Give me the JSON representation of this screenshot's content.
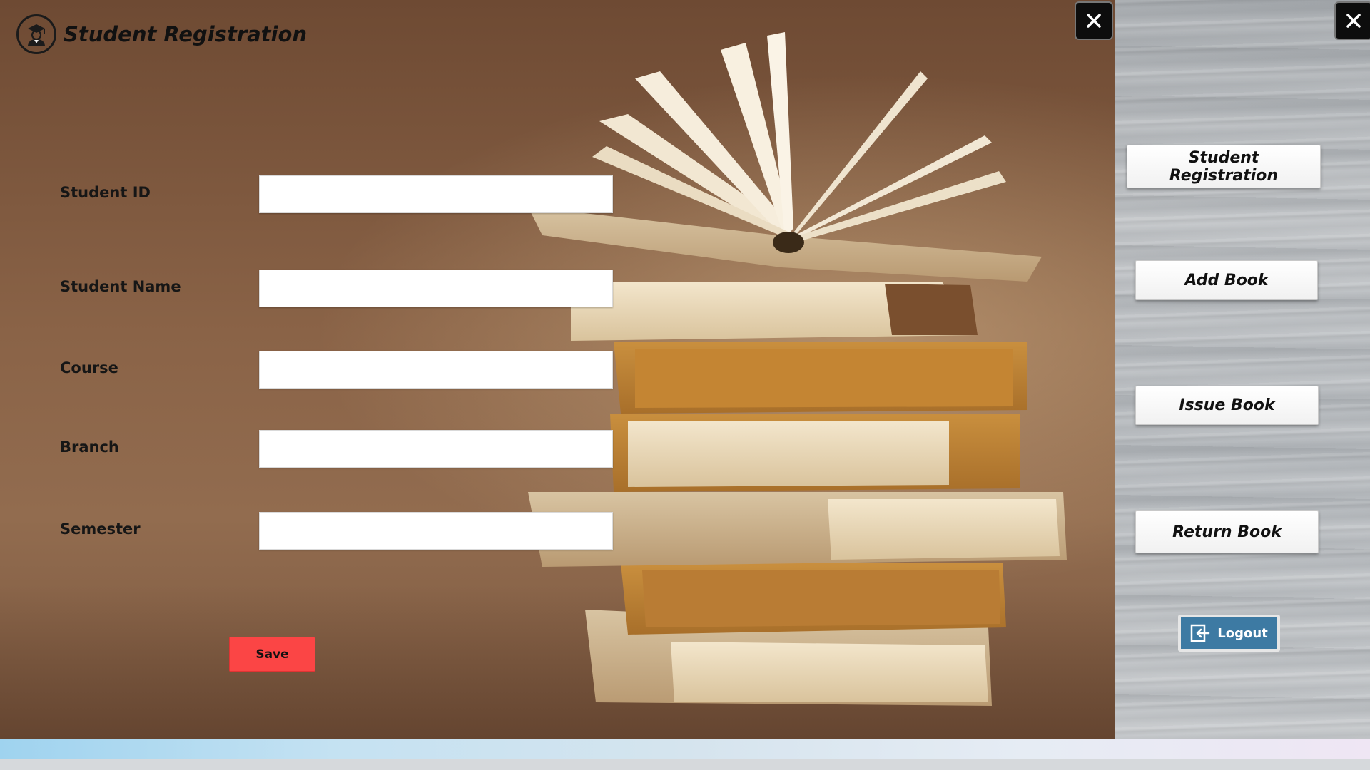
{
  "app": {
    "title": "Student Registration"
  },
  "form": {
    "fields": [
      {
        "label": "Student ID",
        "value": "",
        "placeholder": ""
      },
      {
        "label": "Student Name",
        "value": "",
        "placeholder": ""
      },
      {
        "label": "Course",
        "value": "",
        "placeholder": ""
      },
      {
        "label": "Branch",
        "value": "",
        "placeholder": ""
      },
      {
        "label": "Semester",
        "value": "",
        "placeholder": ""
      }
    ],
    "save_label": "Save"
  },
  "sidebar": {
    "items": [
      {
        "label": "Student Registration"
      },
      {
        "label": "Add Book"
      },
      {
        "label": "Issue Book"
      },
      {
        "label": "Return Book"
      }
    ],
    "logout_label": "Logout"
  },
  "colors": {
    "save_button": "#fb4545",
    "logout_button": "#3d7aa3",
    "close_button": "#0d0d0d"
  },
  "icons": {
    "logo": "student-graduate-icon",
    "close": "close-icon",
    "logout": "logout-icon"
  }
}
